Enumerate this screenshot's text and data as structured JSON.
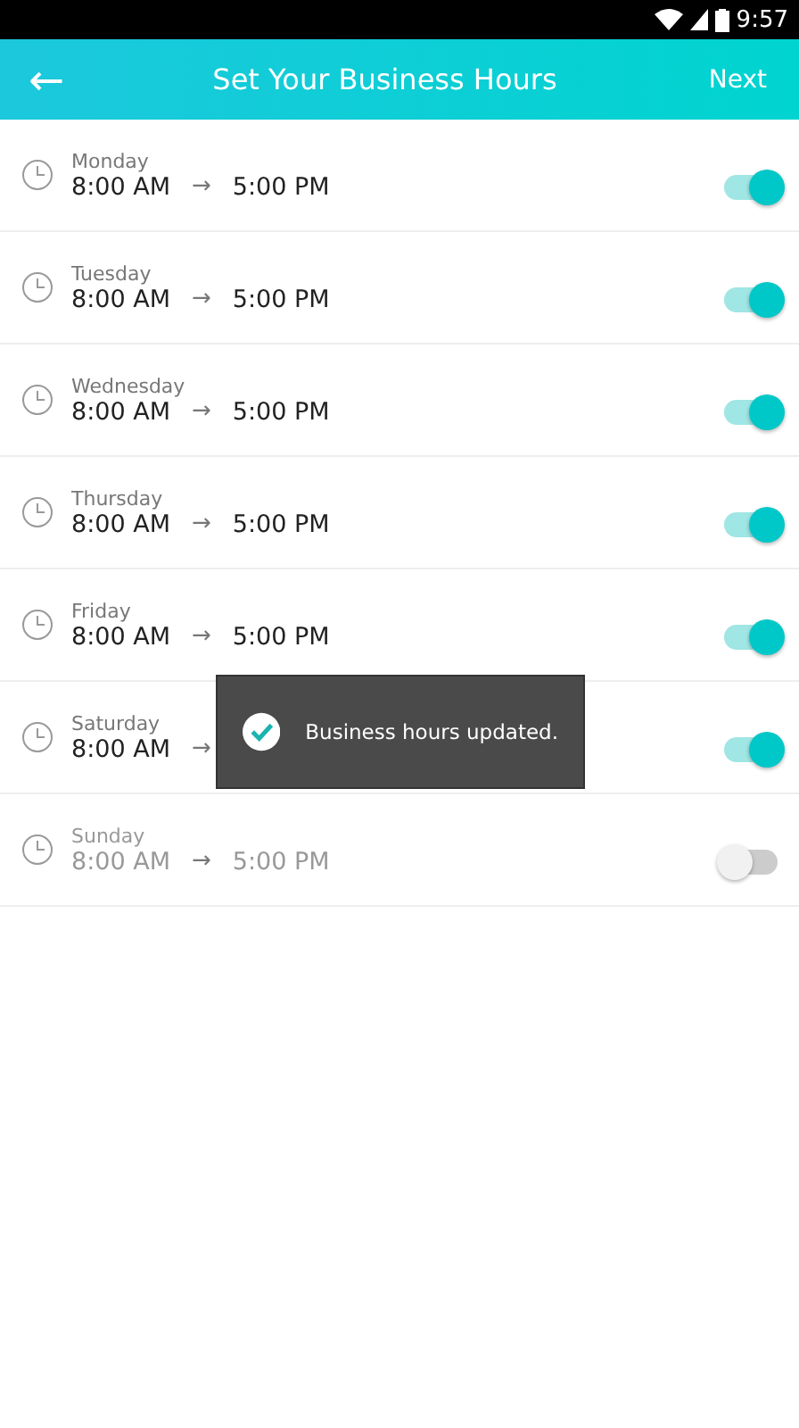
{
  "status_bar": {
    "time": "9:57"
  },
  "header": {
    "back": "←",
    "title": "Set Your Business Hours",
    "next": "Next"
  },
  "days": [
    {
      "day": "Monday",
      "open": "8:00 AM",
      "arrow": "→",
      "close": "5:00 PM",
      "on": true
    },
    {
      "day": "Tuesday",
      "open": "8:00 AM",
      "arrow": "→",
      "close": "5:00 PM",
      "on": true
    },
    {
      "day": "Wednesday",
      "open": "8:00 AM",
      "arrow": "→",
      "close": "5:00 PM",
      "on": true
    },
    {
      "day": "Thursday",
      "open": "8:00 AM",
      "arrow": "→",
      "close": "5:00 PM",
      "on": true
    },
    {
      "day": "Friday",
      "open": "8:00 AM",
      "arrow": "→",
      "close": "5:00 PM",
      "on": true
    },
    {
      "day": "Saturday",
      "open": "8:00 AM",
      "arrow": "→",
      "on": true
    },
    {
      "day": "Sunday",
      "open": "8:00 AM",
      "arrow": "→",
      "close": "5:00 PM",
      "on": false
    }
  ],
  "toast": {
    "message": "Business hours updated."
  }
}
